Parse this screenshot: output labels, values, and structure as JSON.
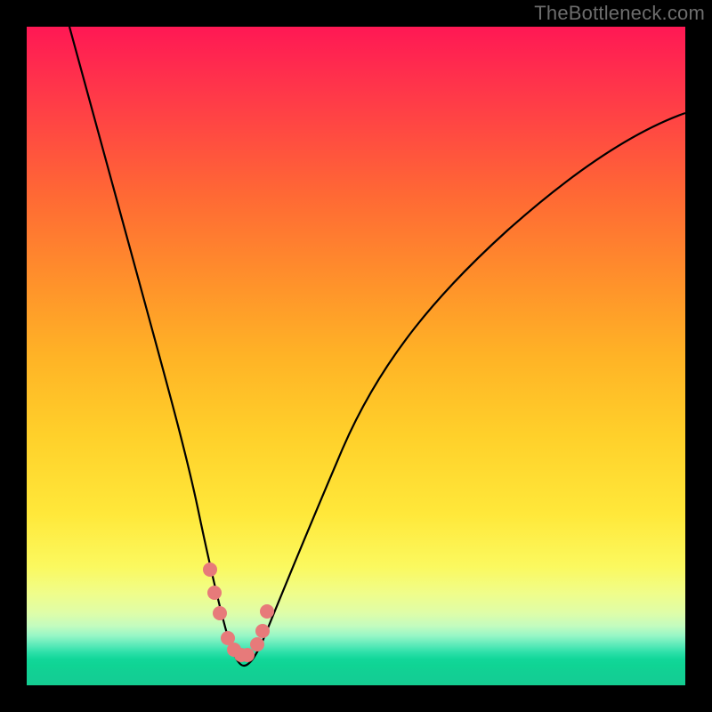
{
  "watermark": "TheBottleneck.com",
  "colors": {
    "frame": "#000000",
    "line": "#000000",
    "markers": "#e77a7a",
    "gradient_top": "#ff1854",
    "gradient_bottom": "#14cc90"
  },
  "chart_data": {
    "type": "line",
    "title": "",
    "xlabel": "",
    "ylabel": "",
    "xlim": [
      0,
      100
    ],
    "ylim": [
      0,
      100
    ],
    "series": [
      {
        "name": "bottleneck-curve",
        "x": [
          6.5,
          10,
          15,
          18,
          21,
          24,
          26,
          28,
          30,
          31,
          32,
          33,
          34,
          36,
          38,
          42,
          48,
          55,
          63,
          72,
          82,
          92,
          100
        ],
        "values": [
          100,
          87,
          69,
          58,
          47,
          36,
          27,
          19,
          11,
          7,
          4,
          3,
          3,
          4,
          8,
          17,
          29,
          40,
          50,
          59,
          67,
          74,
          79
        ]
      }
    ],
    "markers": {
      "name": "highlight-points",
      "x": [
        27.8,
        28.5,
        29.3,
        30.5,
        31.5,
        32.5,
        33.5,
        35.0,
        35.8,
        36.5
      ],
      "values": [
        17.5,
        14.0,
        11.0,
        7.2,
        5.3,
        4.5,
        4.5,
        6.3,
        8.3,
        11.2
      ]
    },
    "grid": false,
    "legend": false
  }
}
